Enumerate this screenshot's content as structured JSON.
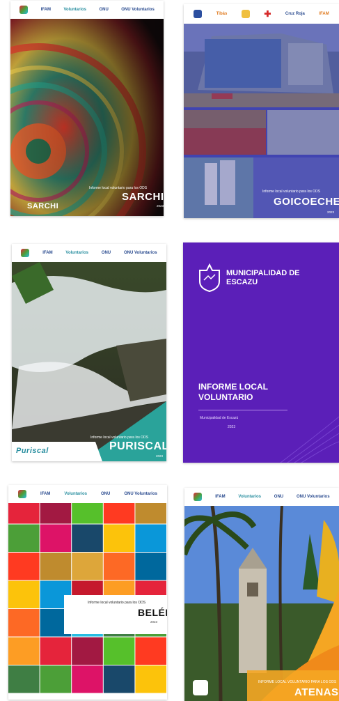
{
  "covers": [
    {
      "logos": [
        "IFAM",
        "Voluntarios",
        "ONU",
        "ONU Voluntarios"
      ],
      "subtitle": "Informe local voluntario para los ODS",
      "title": "SARCHI",
      "year": "2023",
      "municipality_logo": "SARCHI"
    },
    {
      "logos": [
        "Tibás",
        "",
        "",
        "Cruz Roja",
        "IFAM"
      ],
      "subtitle": "Informe local voluntario para los ODS",
      "title": "GOICOECHEA",
      "year": "2023"
    },
    {
      "logos": [
        "IFAM",
        "Voluntarios",
        "ONU",
        "ONU Voluntarios"
      ],
      "subtitle": "Informe local voluntario para los ODS",
      "title": "PURISCAL",
      "year": "2023",
      "municipality_logo": "Puriscal"
    },
    {
      "org_name": "MUNICIPALIDAD DE ESCAZU",
      "title": "INFORME LOCAL VOLUNTARIO",
      "subtitle": "Municipalidad de Escazú",
      "year": "2023"
    },
    {
      "logos": [
        "IFAM",
        "Voluntarios",
        "ONU",
        "ONU Voluntarios"
      ],
      "subtitle": "Informe local voluntario para los ODS",
      "title": "BELÉN",
      "year": "2023"
    },
    {
      "logos": [
        "IFAM",
        "Voluntarios",
        "ONU",
        "ONU Voluntarios"
      ],
      "subtitle": "INFORME LOCAL VOLUNTARIO PARA LOS ODS",
      "title": "ATENAS"
    }
  ],
  "colors": {
    "escazu_purple": "#5b1fb8",
    "puriscal_teal": "#2aa39a",
    "goico_blue": "#3d3fa8",
    "atenas_orange": "#f5a623"
  },
  "sdg_tile_colors": [
    "#e5243b",
    "#dda63a",
    "#4c9f38",
    "#c5192d",
    "#ff3a21",
    "#26bde2",
    "#fcc30b",
    "#a21942",
    "#fd6925",
    "#dd1367",
    "#fd9d24",
    "#bf8b2e",
    "#3f7e44",
    "#0a97d9",
    "#56c02b",
    "#00689d",
    "#19486a"
  ]
}
